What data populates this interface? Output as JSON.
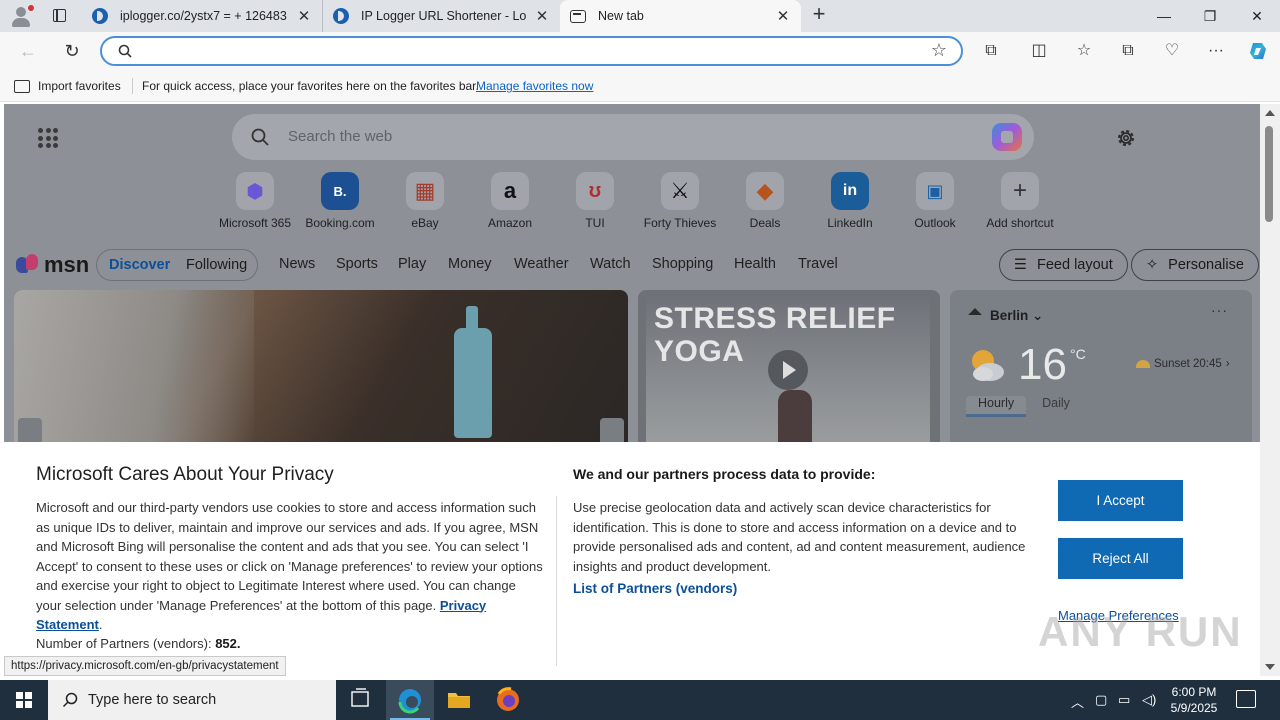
{
  "browser": {
    "tabs": [
      {
        "title": "iplogger.co/2ystx7 = + 126483"
      },
      {
        "title": "IP Logger URL Shortener - Log and"
      },
      {
        "title": "New tab"
      }
    ],
    "new_tab_symbol": "+",
    "window_controls": {
      "minimize": "—",
      "restore": "❐",
      "close": "✕"
    },
    "address": {
      "value": "",
      "placeholder": ""
    },
    "favorites_bar": {
      "import_label": "Import favorites",
      "message": "For quick access, place your favorites here on the favorites bar.",
      "link": "Manage favorites now"
    }
  },
  "newtab": {
    "search_placeholder": "Search the web",
    "shortcuts": [
      {
        "label": "Microsoft 365",
        "icon": "microsoft-365-icon",
        "glyph": "⬢",
        "color": "#6b57d6"
      },
      {
        "label": "Booking.com",
        "icon": "booking-icon",
        "glyph": "B.",
        "color": "#0c3b7c"
      },
      {
        "label": "eBay",
        "icon": "ebay-icon",
        "glyph": "▦",
        "color": "#c0392b"
      },
      {
        "label": "Amazon",
        "icon": "amazon-icon",
        "glyph": "a",
        "color": "#111111"
      },
      {
        "label": "TUI",
        "icon": "tui-icon",
        "glyph": "ʊ",
        "color": "#d6342d"
      },
      {
        "label": "Forty Thieves",
        "icon": "forty-thieves-icon",
        "glyph": "⚔",
        "color": "#111111"
      },
      {
        "label": "Deals",
        "icon": "deals-icon",
        "glyph": "◆",
        "color": "#d35b21"
      },
      {
        "label": "LinkedIn",
        "icon": "linkedin-icon",
        "glyph": "in",
        "color": "#0a5fa8"
      },
      {
        "label": "Outlook",
        "icon": "outlook-icon",
        "glyph": "▣",
        "color": "#0c5fb5"
      },
      {
        "label": "Add shortcut",
        "icon": "plus-icon",
        "glyph": "+",
        "color": "#3a3a3a"
      }
    ],
    "msn": {
      "logo": "msn",
      "feed_tabs": [
        "Discover",
        "Following"
      ],
      "categories": [
        "News",
        "Sports",
        "Play",
        "Money",
        "Weather",
        "Watch",
        "Shopping",
        "Health",
        "Travel"
      ],
      "feed_layout": "Feed layout",
      "personalise": "Personalise"
    },
    "video_card": {
      "title_line1": "STRESS RELIEF",
      "title_line2": "YOGA"
    },
    "weather": {
      "city": "Berlin",
      "temp": "16",
      "unit": "°C",
      "sunset": "Sunset 20:45",
      "tabs": [
        "Hourly",
        "Daily"
      ],
      "more": "···"
    }
  },
  "privacy": {
    "title": "Microsoft Cares About Your Privacy",
    "body": "Microsoft and our third-party vendors use cookies to store and access information such as unique IDs to deliver, maintain and improve our services and ads. If you agree, MSN and Microsoft Bing will personalise the content and ads that you see. You can select 'I Accept' to consent to these uses or click on 'Manage preferences' to review your options and exercise your right to object to Legitimate Interest where used.  You can change your selection under 'Manage Preferences' at the bottom of this page.",
    "privacy_link": "Privacy Statement",
    "partners_label": "Number of Partners (vendors):",
    "partners_count": "852.",
    "right_title": "We and our partners process data to provide:",
    "right_body": "Use precise geolocation data and actively scan device characteristics for identification. This is done to store and access information on a device and to provide personalised ads and content, ad and content measurement, audience insights and product development.",
    "partners_link": "List of Partners (vendors)",
    "accept": "I Accept",
    "reject": "Reject All",
    "manage": "Manage Preferences"
  },
  "status_bar_url": "https://privacy.microsoft.com/en-gb/privacystatement",
  "watermark": "ANY RUN",
  "taskbar": {
    "search_placeholder": "Type here to search",
    "time": "6:00 PM",
    "date": "5/9/2025"
  }
}
